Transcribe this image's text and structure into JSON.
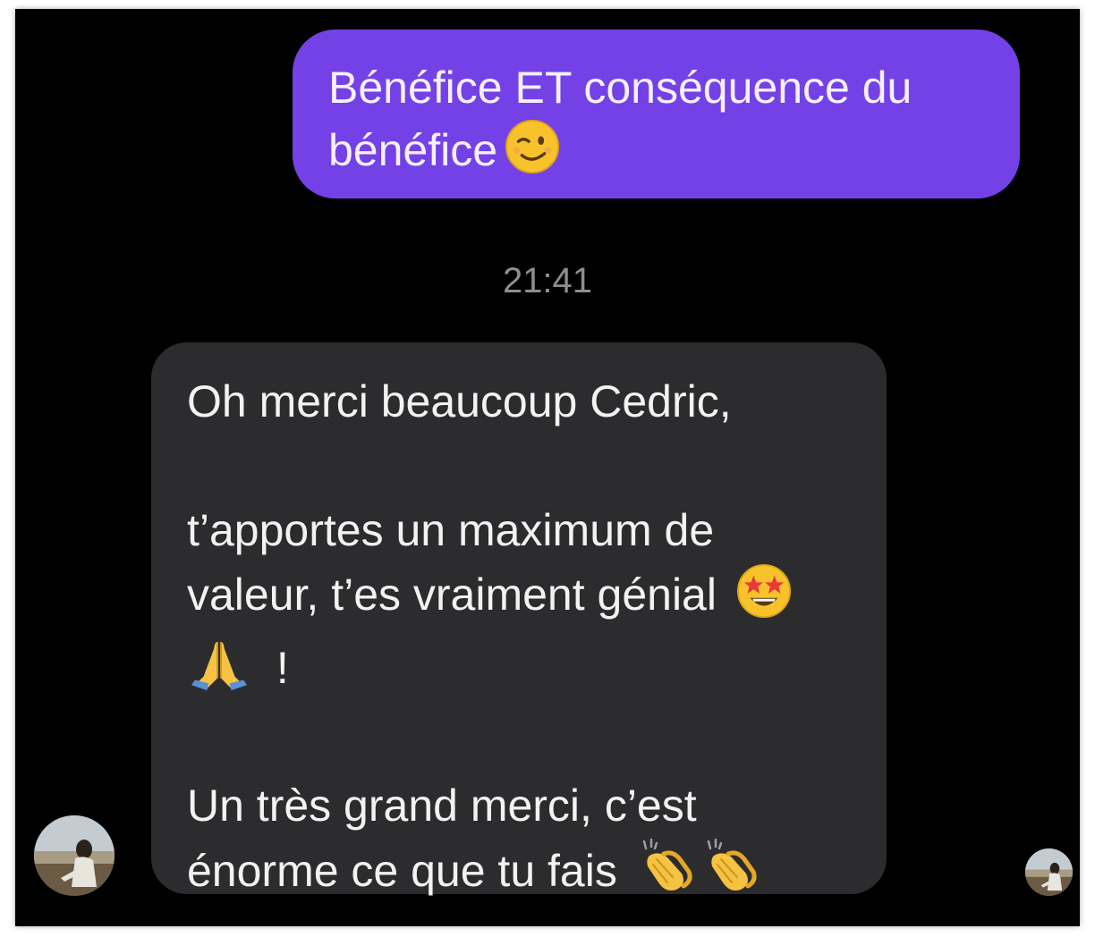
{
  "conversation": {
    "sent_message": {
      "text": "Bénéfice ET conséquence du bénéfice",
      "emoji": "winking-face"
    },
    "timestamp": "21:41",
    "received_message": {
      "line1": "Oh merci beaucoup Cedric,",
      "line2": "t’apportes un maximum de valeur, t’es vraiment génial",
      "line2_emojis": [
        "star-struck",
        "folded-hands"
      ],
      "line2_suffix": "!",
      "line3": "Un très grand merci, c’est énorme ce que tu fais",
      "line3_emojis": [
        "clapping-hands",
        "clapping-hands"
      ]
    }
  },
  "colors": {
    "background": "#000000",
    "sent_bubble": "#7441e7",
    "received_bubble": "#2c2c2e",
    "timestamp": "#8e8e93"
  }
}
